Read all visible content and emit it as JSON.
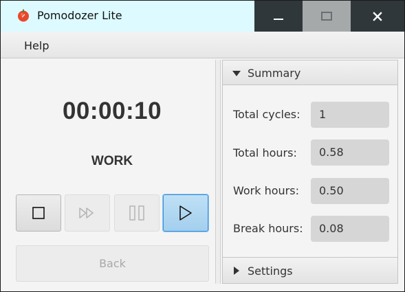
{
  "window": {
    "title": "Pomodozer Lite",
    "icon": "tomato-icon",
    "controls": [
      "minimize-icon",
      "maximize-icon",
      "close-icon"
    ]
  },
  "menu": {
    "items": [
      {
        "label": "Help"
      }
    ]
  },
  "timer": {
    "time": "00:00:10",
    "mode": "WORK",
    "controls": [
      {
        "icon": "stop-icon",
        "enabled": true
      },
      {
        "icon": "skip-icon",
        "enabled": false
      },
      {
        "icon": "pause-icon",
        "enabled": false
      },
      {
        "icon": "play-icon",
        "enabled": true,
        "focused": true
      }
    ],
    "back_label": "Back",
    "back_enabled": false
  },
  "summary": {
    "title": "Summary",
    "expanded": true,
    "stats": [
      {
        "label": "Total cycles:",
        "value": "1"
      },
      {
        "label": "Total hours:",
        "value": "0.58"
      },
      {
        "label": "Work hours:",
        "value": "0.50"
      },
      {
        "label": "Break hours:",
        "value": "0.08"
      }
    ]
  },
  "settings": {
    "title": "Settings",
    "expanded": false
  },
  "colors": {
    "titlebar_bg": "#dcfaff",
    "window_button_bg": "#2f373b",
    "accent_focus": "#3d8fd9"
  }
}
